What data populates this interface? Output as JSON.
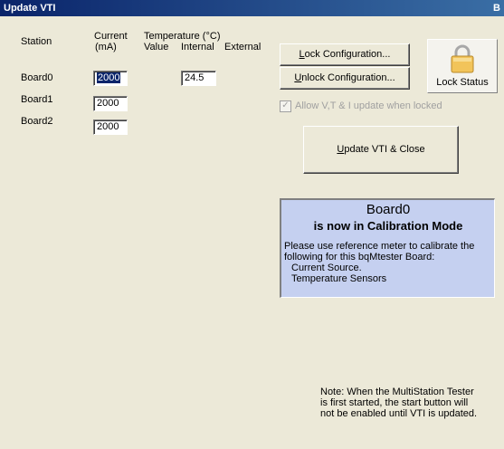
{
  "window": {
    "title": "Update VTI",
    "title_right": "B"
  },
  "headers": {
    "station": "Station",
    "current_line1": "Current",
    "current_line2": "(mA)",
    "temperature": "Temperature (°C)",
    "value": "Value",
    "internal": "Internal",
    "external": "External"
  },
  "rows": [
    {
      "station": "Board0",
      "current": "2000",
      "internal": "24.5"
    },
    {
      "station": "Board1",
      "current": "2000"
    },
    {
      "station": "Board2",
      "current": "2000"
    }
  ],
  "buttons": {
    "lock": {
      "pre": "",
      "u": "L",
      "post": "ock Configuration..."
    },
    "unlock": {
      "pre": "",
      "u": "U",
      "post": "nlock Configuration..."
    },
    "update": {
      "pre": "",
      "u": "U",
      "post": "pdate VTI & Close"
    }
  },
  "lock_status": {
    "label": "Lock Status",
    "icon": "padlock-icon"
  },
  "allow_checkbox": {
    "label": "Allow V,T & I update when locked",
    "checked": true
  },
  "calibration": {
    "board": "Board0",
    "headline": "is now in Calibration Mode",
    "body_line1": "Please use reference meter to calibrate the",
    "body_line2": "following for this bqMtester Board:",
    "item1": "Current Source.",
    "item2": "Temperature Sensors"
  },
  "note": {
    "line1": "Note: When the MultiStation Tester",
    "line2": "is first started, the start button will",
    "line3": "not be enabled until VTI is updated."
  },
  "colors": {
    "title_bar": "#0a246a",
    "calibration_bg": "#c5d0f0",
    "dialog_bg": "#ece9d8"
  }
}
